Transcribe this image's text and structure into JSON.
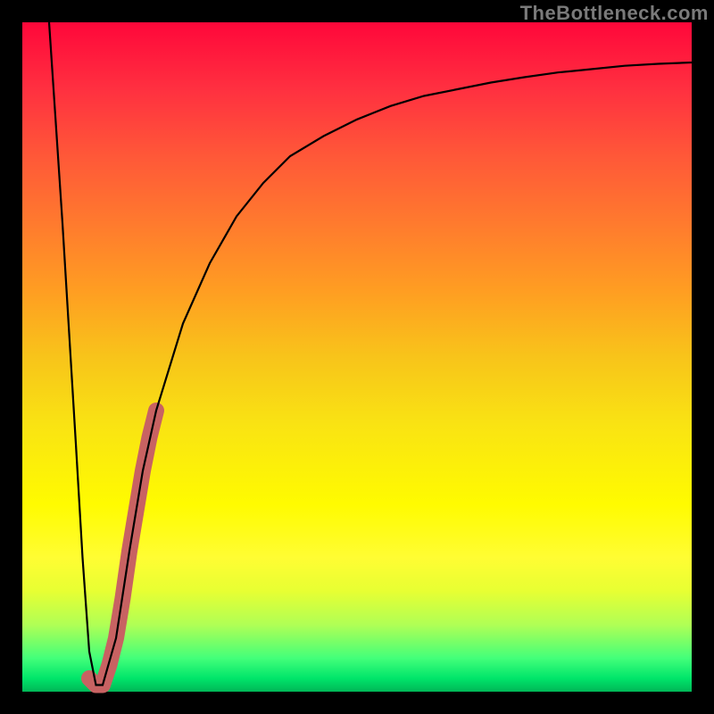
{
  "watermark": "TheBottleneck.com",
  "chart_data": {
    "type": "line",
    "title": "",
    "xlabel": "",
    "ylabel": "",
    "xlim": [
      0,
      100
    ],
    "ylim": [
      0,
      100
    ],
    "grid": false,
    "legend": false,
    "series": [
      {
        "name": "curve",
        "color": "#000000",
        "x": [
          4,
          6,
          8,
          9,
          10,
          11,
          12,
          14,
          16,
          18,
          20,
          24,
          28,
          32,
          36,
          40,
          45,
          50,
          55,
          60,
          65,
          70,
          75,
          80,
          85,
          90,
          95,
          100
        ],
        "y": [
          100,
          70,
          37,
          20,
          6,
          1,
          1,
          8,
          21,
          33,
          42,
          55,
          64,
          71,
          76,
          80,
          83,
          85.5,
          87.5,
          89,
          90,
          91,
          91.8,
          92.5,
          93,
          93.5,
          93.8,
          94
        ]
      },
      {
        "name": "highlight",
        "color": "#c86262",
        "x": [
          10,
          11,
          12,
          13,
          14,
          15,
          16,
          17,
          18,
          19,
          20
        ],
        "y": [
          2,
          1,
          1,
          4,
          8,
          14,
          21,
          27,
          33,
          38,
          42
        ]
      }
    ],
    "gradient_background": {
      "top_color": "#ff073a",
      "bottom_color": "#00b757"
    }
  }
}
